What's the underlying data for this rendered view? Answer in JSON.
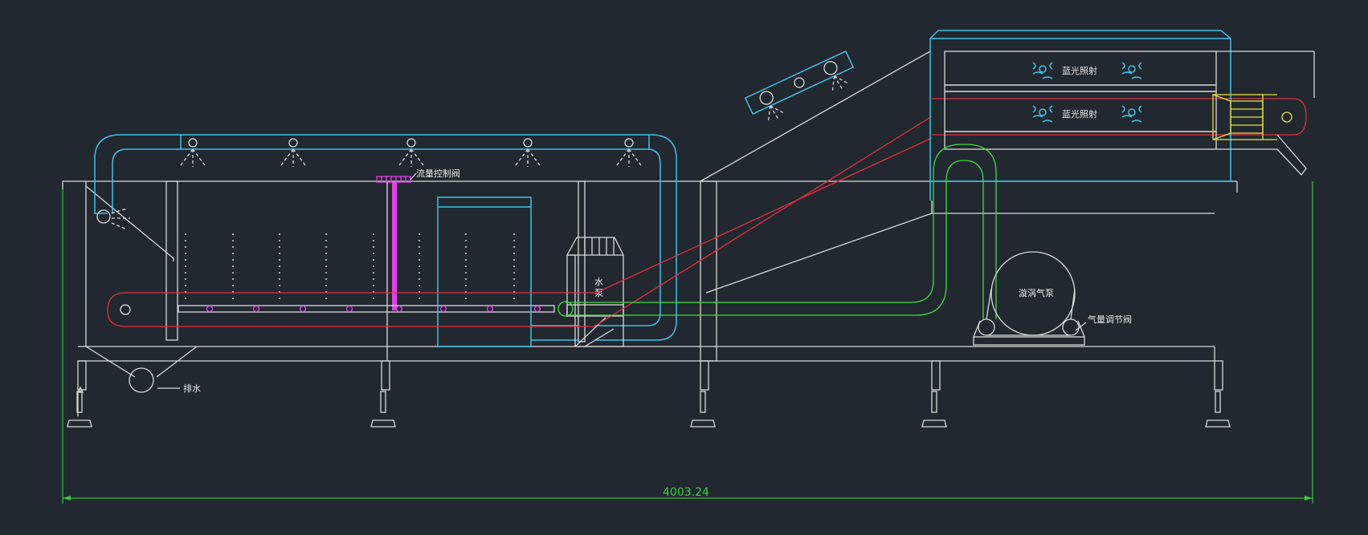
{
  "labels": {
    "blue_light_1": "蓝光照射",
    "blue_light_2": "蓝光照射",
    "flow_control_valve": "流量控制阀",
    "water_pump_1": "水",
    "water_pump_2": "泵",
    "vortex_air_pump": "漩涡气泵",
    "air_adjust_valve": "气量调节阀",
    "drain": "排水",
    "overall_length": "4003.24"
  },
  "colors": {
    "background": "#212830",
    "frame": "#d9d9d9",
    "water_pipe": "#3fc2e4",
    "conveyor": "#e52d3f",
    "air_pipe": "#3ede3e",
    "valve": "#e43fe8",
    "feeder": "#e8e23a",
    "dimension": "#34d13d"
  }
}
